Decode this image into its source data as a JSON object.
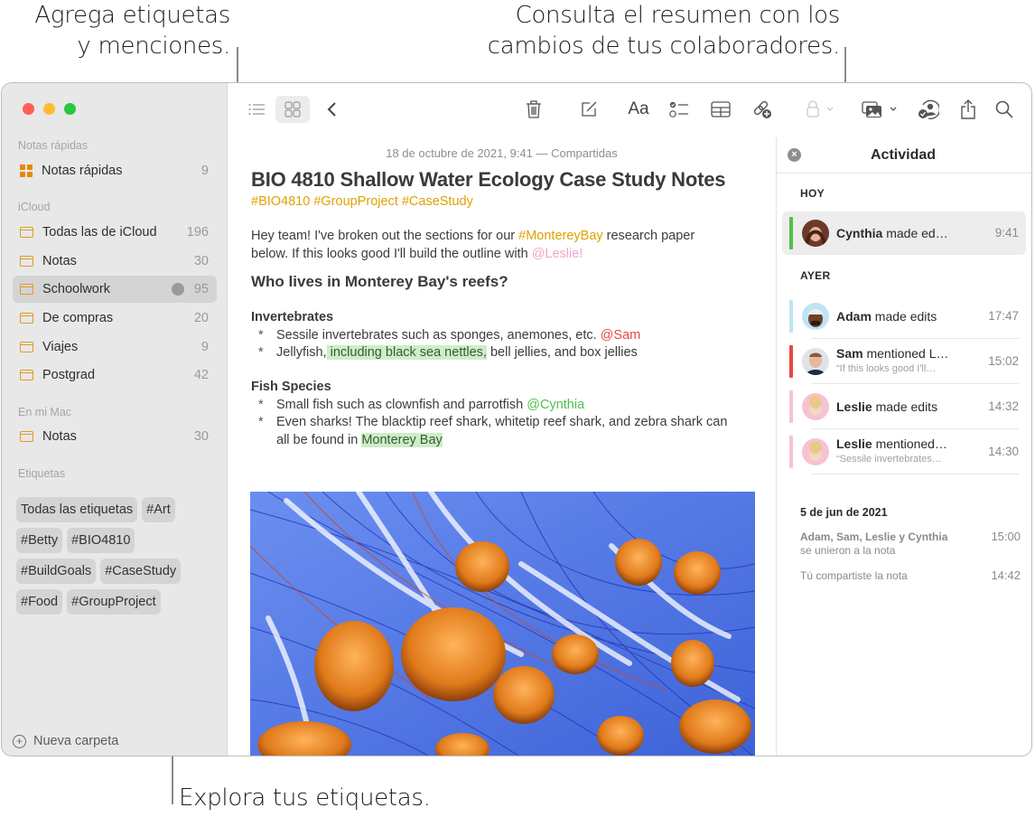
{
  "callouts": {
    "top_left": [
      "Agrega etiquetas",
      "y menciones."
    ],
    "top_right": [
      "Consulta el resumen con los",
      "cambios de tus colaboradores."
    ],
    "bottom": "Explora tus etiquetas."
  },
  "colors": {
    "accent_orange": "#e29a24",
    "tag_yellow": "#e0a100",
    "highlight_green": "#cdeec6",
    "cynthia": "#4fc04a",
    "adam": "#bfe4f6",
    "sam": "#e6493f",
    "leslie": "#f7c2d2"
  },
  "sidebar": {
    "sections": [
      {
        "header": "Notas rápidas",
        "items": [
          {
            "label": "Notas rápidas",
            "count": "9",
            "icon": "quick-notes-icon"
          }
        ]
      },
      {
        "header": "iCloud",
        "items": [
          {
            "label": "Todas las de iCloud",
            "count": "196",
            "icon": "folder-icon"
          },
          {
            "label": "Notas",
            "count": "30",
            "icon": "folder-icon"
          },
          {
            "label": "Schoolwork",
            "count": "95",
            "icon": "folder-icon",
            "selected": true,
            "shared": true
          },
          {
            "label": "De compras",
            "count": "20",
            "icon": "folder-icon"
          },
          {
            "label": "Viajes",
            "count": "9",
            "icon": "folder-icon"
          },
          {
            "label": "Postgrad",
            "count": "42",
            "icon": "folder-icon"
          }
        ]
      },
      {
        "header": "En mi Mac",
        "items": [
          {
            "label": "Notas",
            "count": "30",
            "icon": "folder-icon"
          }
        ]
      }
    ],
    "tags_header": "Etiquetas",
    "tags": [
      "Todas las etiquetas",
      "#Art",
      "#Betty",
      "#BIO4810",
      "#BuildGoals",
      "#CaseStudy",
      "#Food",
      "#GroupProject"
    ],
    "new_folder": "Nueva carpeta"
  },
  "toolbar": {
    "left": [
      "list-view-icon",
      "gallery-view-icon",
      "back-icon"
    ],
    "right": [
      "trash-icon",
      "compose-icon",
      "format-icon",
      "checklist-icon",
      "table-icon",
      "collaborate-link-icon",
      "lock-icon",
      "media-icon",
      "activity-icon",
      "share-icon",
      "search-icon"
    ],
    "format_label": "Aa"
  },
  "note": {
    "date": "18 de octubre de 2021, 9:41 — Compartidas",
    "title": "BIO 4810 Shallow Water Ecology Case Study Notes",
    "hashtags": "#BIO4810 #GroupProject #CaseStudy",
    "intro": {
      "a": "Hey team! I've broken out the sections for our ",
      "tag": "#MontereyBay",
      "b": " research paper",
      "c": "below. If this looks good I'll build the outline with ",
      "mention": "@Leslie!"
    },
    "heading": "Who lives in Monterey Bay's reefs?",
    "sections": [
      {
        "title": "Invertebrates",
        "bullets": [
          {
            "a": "Sessile invertebrates such as sponges, anemones, etc. ",
            "mention": "@Sam"
          },
          {
            "a": "Jellyfish,",
            "hl": " including black sea nettles,",
            "b": " bell jellies, and box jellies"
          }
        ]
      },
      {
        "title": "Fish Species",
        "bullets": [
          {
            "a": "Small fish such as clownfish and parrotfish ",
            "mention": "@Cynthia"
          },
          {
            "a": "Even sharks! The blacktip reef shark, whitetip reef shark, and zebra shark can",
            "b": "all be found in ",
            "hl": "Monterey Bay"
          }
        ]
      }
    ],
    "bullet_char": "*"
  },
  "activity": {
    "title": "Actividad",
    "today": "HOY",
    "yesterday": "AYER",
    "entries": [
      {
        "name": "Cynthia",
        "action": " made ed…",
        "time": "9:41",
        "selected": true
      },
      {
        "name": "Adam",
        "action": " made edits",
        "time": "17:47"
      },
      {
        "name": "Sam",
        "action": " mentioned L…",
        "sub": "“If this looks good I'll…",
        "time": "15:02"
      },
      {
        "name": "Leslie",
        "action": " made edits",
        "time": "14:32"
      },
      {
        "name": "Leslie",
        "action": " mentioned…",
        "sub": "“Sessile invertebrates…",
        "time": "14:30"
      }
    ],
    "older_date": "5 de jun de 2021",
    "older": [
      {
        "bold": "Adam, Sam, Leslie y Cynthia",
        "text": "se unieron a la nota",
        "time": "15:00"
      },
      {
        "text": "Tú compartiste la nota",
        "time": "14:42"
      }
    ]
  }
}
